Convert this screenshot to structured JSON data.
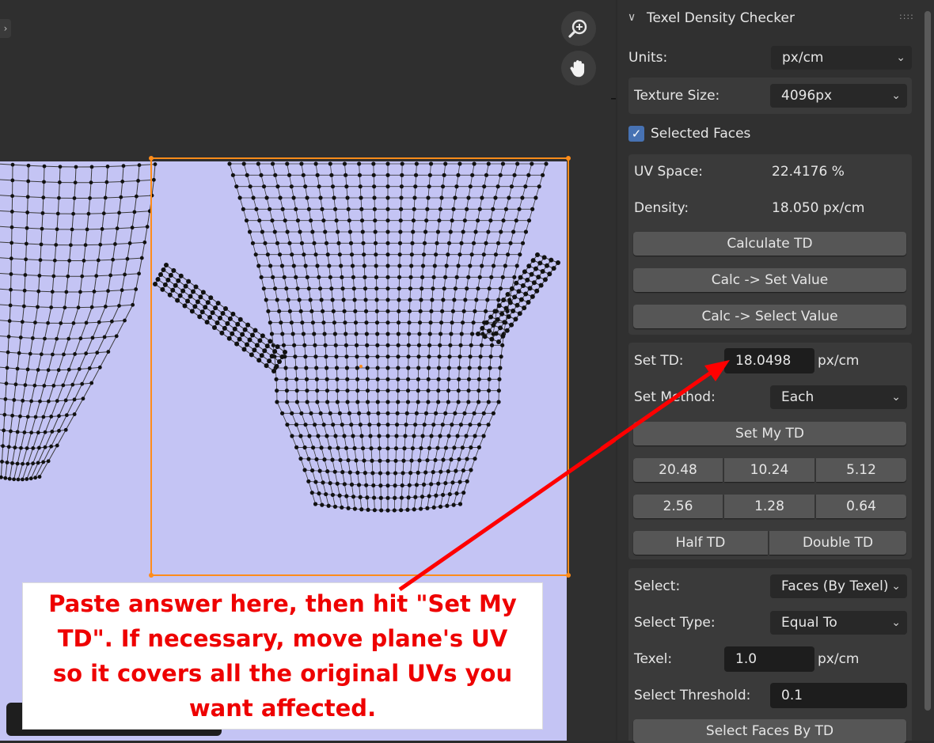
{
  "panel": {
    "title": "Texel Density Checker",
    "units_label": "Units:",
    "units_value": "px/cm",
    "texture_size_label": "Texture Size:",
    "texture_size_value": "4096px",
    "selected_faces_label": "Selected Faces",
    "selected_faces_checked": true,
    "uv_space_label": "UV Space:",
    "uv_space_value": "22.4176 %",
    "density_label": "Density:",
    "density_value": "18.050 px/cm",
    "calculate_td": "Calculate TD",
    "calc_set_value": "Calc -> Set Value",
    "calc_select_value": "Calc -> Select Value",
    "set_td_label": "Set TD:",
    "set_td_value": "18.0498",
    "set_td_unit": "px/cm",
    "set_method_label": "Set Method:",
    "set_method_value": "Each",
    "set_my_td": "Set My TD",
    "presets": [
      "20.48",
      "10.24",
      "5.12",
      "2.56",
      "1.28",
      "0.64"
    ],
    "half_td": "Half TD",
    "double_td": "Double TD",
    "select_label": "Select:",
    "select_value": "Faces (By Texel)",
    "select_type_label": "Select Type:",
    "select_type_value": "Equal To",
    "texel_label": "Texel:",
    "texel_value": "1.0",
    "texel_unit": "px/cm",
    "select_threshold_label": "Select Threshold:",
    "select_threshold_value": "0.1",
    "select_faces_by_td": "Select Faces By TD"
  },
  "annotation": {
    "text": "Paste answer here, then hit \"Set My TD\". If necessary, move plane's UV so it covers all the original UVs you want affected."
  },
  "colors": {
    "uv_background": "#c4c4f4",
    "selection_border": "#ff8c1a",
    "annotation_text": "#ee0000",
    "arrow": "#ff0000",
    "checkbox": "#4772b3"
  },
  "icons": [
    "zoom-in-icon",
    "hand-pan-icon",
    "chevron-right-icon",
    "chevron-down-icon",
    "drag-handle-icon"
  ]
}
